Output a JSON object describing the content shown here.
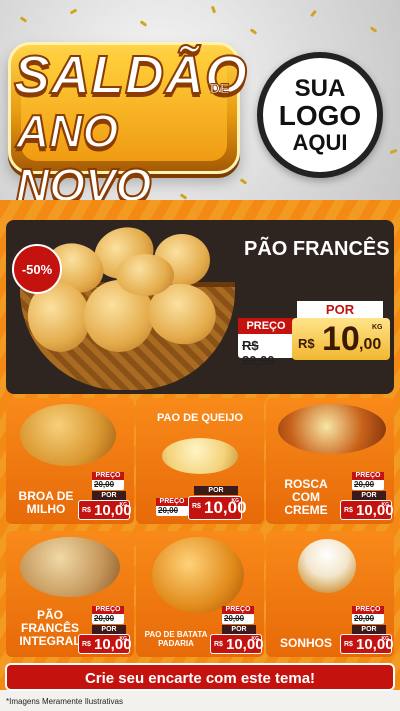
{
  "header": {
    "title_line1": "SALDÃO",
    "title_de": "DE",
    "title_line2": "ANO NOVO",
    "logo_lines": [
      "SUA",
      "LOGO",
      "AQUI"
    ]
  },
  "featured": {
    "discount": "-50%",
    "name": "PÃO FRANCÊS",
    "preco_label": "PREÇO",
    "old_price": "R$ 20,00",
    "por_label": "POR",
    "currency": "R$",
    "price_int": "10",
    "price_dec": ",00",
    "unit": "KG"
  },
  "products": [
    {
      "name": "BROA DE MILHO",
      "preco_label": "PREÇO",
      "old_price": "20,00",
      "por_label": "POR",
      "currency": "R$",
      "price": "10,00",
      "unit": "KG"
    },
    {
      "name": "PAO DE QUEIJO",
      "preco_label": "PREÇO",
      "old_price": "20,00",
      "por_label": "POR",
      "currency": "R$",
      "price": "10,00",
      "unit": "KG"
    },
    {
      "name": "ROSCA COM CREME",
      "preco_label": "PREÇO",
      "old_price": "20,00",
      "por_label": "POR",
      "currency": "R$",
      "price": "10,00",
      "unit": "KG"
    },
    {
      "name": "PÃO FRANCÊS INTEGRAL",
      "preco_label": "PREÇO",
      "old_price": "20,00",
      "por_label": "POR",
      "currency": "R$",
      "price": "10,00",
      "unit": "KG"
    },
    {
      "name": "PAO DE BATATA PADARIA",
      "preco_label": "PREÇO",
      "old_price": "20,00",
      "por_label": "POR",
      "currency": "R$",
      "price": "10,00",
      "unit": "KG"
    },
    {
      "name": "SONHOS",
      "preco_label": "PREÇO",
      "old_price": "20,00",
      "por_label": "POR",
      "currency": "R$",
      "price": "10,00",
      "unit": "KG"
    }
  ],
  "cta": "Crie seu encarte com este tema!",
  "disclaimer": "*Imagens Meramente Ilustrativas",
  "colors": {
    "accent_red": "#c4120f",
    "orange": "#f28a13",
    "gold": "#f2b730",
    "dark_brown": "#2e2420"
  }
}
